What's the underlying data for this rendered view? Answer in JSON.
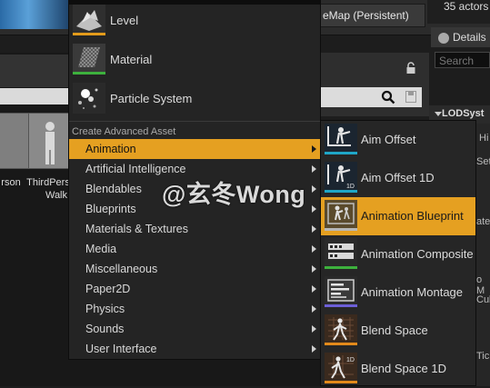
{
  "editor": {
    "map_title": "eMap (Persistent)",
    "actor_count": "35 actors",
    "details_tab": "Details",
    "details_search_placeholder": "Search",
    "lod_section": "LODSyst",
    "tiles": [
      {
        "label_line1": "rson",
        "label_line2": ""
      },
      {
        "label_line1": "ThirdPers",
        "label_line2": "Walk"
      }
    ],
    "right_panel_fragments": [
      "Hi",
      "Setu",
      "ate",
      "o M",
      "Cul",
      "Tick"
    ]
  },
  "asset_menu": {
    "basic_assets": [
      {
        "label": "Level",
        "icon": "level-icon",
        "accent": "#e39b1b"
      },
      {
        "label": "Material",
        "icon": "material-icon",
        "accent": "#3db13d"
      },
      {
        "label": "Particle System",
        "icon": "particle-system-icon",
        "accent": "#e0e0e0"
      }
    ],
    "advanced_header": "Create Advanced Asset",
    "categories": [
      {
        "label": "Animation",
        "active": true
      },
      {
        "label": "Artificial Intelligence"
      },
      {
        "label": "Blendables"
      },
      {
        "label": "Blueprints"
      },
      {
        "label": "Materials & Textures"
      },
      {
        "label": "Media"
      },
      {
        "label": "Miscellaneous"
      },
      {
        "label": "Paper2D"
      },
      {
        "label": "Physics"
      },
      {
        "label": "Sounds"
      },
      {
        "label": "User Interface"
      }
    ]
  },
  "animation_submenu": {
    "items": [
      {
        "label": "Aim Offset",
        "icon": "aim-offset-icon",
        "accent": "#1fa6c7"
      },
      {
        "label": "Aim Offset 1D",
        "icon": "aim-offset-1d-icon",
        "accent": "#1fa6c7"
      },
      {
        "label": "Animation Blueprint",
        "icon": "animation-blueprint-icon",
        "accent": "#e5a021",
        "active": true
      },
      {
        "label": "Animation Composite",
        "icon": "animation-composite-icon",
        "accent": "#3db13d"
      },
      {
        "label": "Animation Montage",
        "icon": "animation-montage-icon",
        "accent": "#6c5fd6"
      },
      {
        "label": "Blend Space",
        "icon": "blend-space-icon",
        "accent": "#e38a1b"
      },
      {
        "label": "Blend Space 1D",
        "icon": "blend-space-1d-icon",
        "accent": "#e38a1b"
      }
    ]
  },
  "watermark": "@玄冬Wong"
}
